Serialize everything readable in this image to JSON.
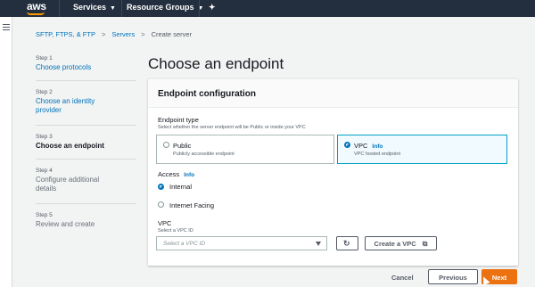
{
  "topnav": {
    "logo": "aws",
    "services": "Services",
    "resource_groups": "Resource Groups",
    "pin_glyph": "✦"
  },
  "breadcrumb": {
    "root": "SFTP, FTPS, & FTP",
    "servers": "Servers",
    "current": "Create server",
    "separator": ">"
  },
  "steps": [
    {
      "label": "Step 1",
      "name": "Choose protocols"
    },
    {
      "label": "Step 2",
      "name": "Choose an identity provider"
    },
    {
      "label": "Step 3",
      "name": "Choose an endpoint"
    },
    {
      "label": "Step 4",
      "name": "Configure additional details"
    },
    {
      "label": "Step 5",
      "name": "Review and create"
    }
  ],
  "page_title": "Choose an endpoint",
  "panel": {
    "title": "Endpoint configuration",
    "endpoint_type": {
      "label": "Endpoint type",
      "description": "Select whether the server endpoint will be Public or inside your VPC",
      "options": [
        {
          "title": "Public",
          "desc": "Publicly accessible endpoint",
          "selected": false
        },
        {
          "title": "VPC",
          "info": "Info",
          "desc": "VPC hosted endpoint",
          "selected": true
        }
      ]
    },
    "access": {
      "label": "Access",
      "info": "Info",
      "options": [
        {
          "label": "Internal",
          "selected": true
        },
        {
          "label": "Internet Facing",
          "selected": false
        }
      ]
    },
    "vpc": {
      "label": "VPC",
      "description": "Select a VPC ID",
      "placeholder": "Select a VPC ID",
      "create_label": "Create a VPC"
    }
  },
  "footer": {
    "cancel": "Cancel",
    "previous": "Previous",
    "next": "Next"
  },
  "colors": {
    "nav_bg": "#232f3e",
    "link": "#0073bb",
    "primary": "#ec7211",
    "selected_border": "#00a1c9"
  }
}
